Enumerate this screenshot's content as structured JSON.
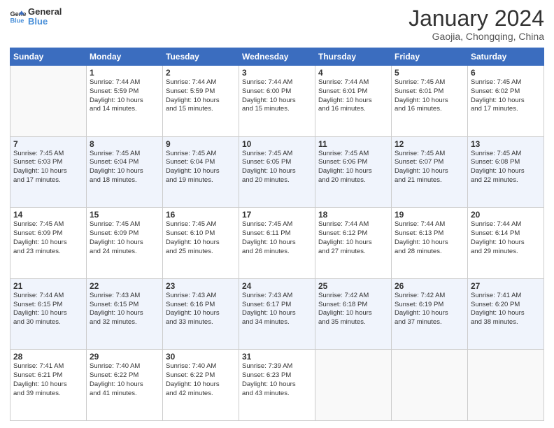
{
  "logo": {
    "line1": "General",
    "line2": "Blue"
  },
  "calendar": {
    "title": "January 2024",
    "subtitle": "Gaojia, Chongqing, China"
  },
  "headers": [
    "Sunday",
    "Monday",
    "Tuesday",
    "Wednesday",
    "Thursday",
    "Friday",
    "Saturday"
  ],
  "weeks": [
    [
      {
        "day": "",
        "info": ""
      },
      {
        "day": "1",
        "info": "Sunrise: 7:44 AM\nSunset: 5:59 PM\nDaylight: 10 hours\nand 14 minutes."
      },
      {
        "day": "2",
        "info": "Sunrise: 7:44 AM\nSunset: 5:59 PM\nDaylight: 10 hours\nand 15 minutes."
      },
      {
        "day": "3",
        "info": "Sunrise: 7:44 AM\nSunset: 6:00 PM\nDaylight: 10 hours\nand 15 minutes."
      },
      {
        "day": "4",
        "info": "Sunrise: 7:44 AM\nSunset: 6:01 PM\nDaylight: 10 hours\nand 16 minutes."
      },
      {
        "day": "5",
        "info": "Sunrise: 7:45 AM\nSunset: 6:01 PM\nDaylight: 10 hours\nand 16 minutes."
      },
      {
        "day": "6",
        "info": "Sunrise: 7:45 AM\nSunset: 6:02 PM\nDaylight: 10 hours\nand 17 minutes."
      }
    ],
    [
      {
        "day": "7",
        "info": "Sunrise: 7:45 AM\nSunset: 6:03 PM\nDaylight: 10 hours\nand 17 minutes."
      },
      {
        "day": "8",
        "info": "Sunrise: 7:45 AM\nSunset: 6:04 PM\nDaylight: 10 hours\nand 18 minutes."
      },
      {
        "day": "9",
        "info": "Sunrise: 7:45 AM\nSunset: 6:04 PM\nDaylight: 10 hours\nand 19 minutes."
      },
      {
        "day": "10",
        "info": "Sunrise: 7:45 AM\nSunset: 6:05 PM\nDaylight: 10 hours\nand 20 minutes."
      },
      {
        "day": "11",
        "info": "Sunrise: 7:45 AM\nSunset: 6:06 PM\nDaylight: 10 hours\nand 20 minutes."
      },
      {
        "day": "12",
        "info": "Sunrise: 7:45 AM\nSunset: 6:07 PM\nDaylight: 10 hours\nand 21 minutes."
      },
      {
        "day": "13",
        "info": "Sunrise: 7:45 AM\nSunset: 6:08 PM\nDaylight: 10 hours\nand 22 minutes."
      }
    ],
    [
      {
        "day": "14",
        "info": "Sunrise: 7:45 AM\nSunset: 6:09 PM\nDaylight: 10 hours\nand 23 minutes."
      },
      {
        "day": "15",
        "info": "Sunrise: 7:45 AM\nSunset: 6:09 PM\nDaylight: 10 hours\nand 24 minutes."
      },
      {
        "day": "16",
        "info": "Sunrise: 7:45 AM\nSunset: 6:10 PM\nDaylight: 10 hours\nand 25 minutes."
      },
      {
        "day": "17",
        "info": "Sunrise: 7:45 AM\nSunset: 6:11 PM\nDaylight: 10 hours\nand 26 minutes."
      },
      {
        "day": "18",
        "info": "Sunrise: 7:44 AM\nSunset: 6:12 PM\nDaylight: 10 hours\nand 27 minutes."
      },
      {
        "day": "19",
        "info": "Sunrise: 7:44 AM\nSunset: 6:13 PM\nDaylight: 10 hours\nand 28 minutes."
      },
      {
        "day": "20",
        "info": "Sunrise: 7:44 AM\nSunset: 6:14 PM\nDaylight: 10 hours\nand 29 minutes."
      }
    ],
    [
      {
        "day": "21",
        "info": "Sunrise: 7:44 AM\nSunset: 6:15 PM\nDaylight: 10 hours\nand 30 minutes."
      },
      {
        "day": "22",
        "info": "Sunrise: 7:43 AM\nSunset: 6:15 PM\nDaylight: 10 hours\nand 32 minutes."
      },
      {
        "day": "23",
        "info": "Sunrise: 7:43 AM\nSunset: 6:16 PM\nDaylight: 10 hours\nand 33 minutes."
      },
      {
        "day": "24",
        "info": "Sunrise: 7:43 AM\nSunset: 6:17 PM\nDaylight: 10 hours\nand 34 minutes."
      },
      {
        "day": "25",
        "info": "Sunrise: 7:42 AM\nSunset: 6:18 PM\nDaylight: 10 hours\nand 35 minutes."
      },
      {
        "day": "26",
        "info": "Sunrise: 7:42 AM\nSunset: 6:19 PM\nDaylight: 10 hours\nand 37 minutes."
      },
      {
        "day": "27",
        "info": "Sunrise: 7:41 AM\nSunset: 6:20 PM\nDaylight: 10 hours\nand 38 minutes."
      }
    ],
    [
      {
        "day": "28",
        "info": "Sunrise: 7:41 AM\nSunset: 6:21 PM\nDaylight: 10 hours\nand 39 minutes."
      },
      {
        "day": "29",
        "info": "Sunrise: 7:40 AM\nSunset: 6:22 PM\nDaylight: 10 hours\nand 41 minutes."
      },
      {
        "day": "30",
        "info": "Sunrise: 7:40 AM\nSunset: 6:22 PM\nDaylight: 10 hours\nand 42 minutes."
      },
      {
        "day": "31",
        "info": "Sunrise: 7:39 AM\nSunset: 6:23 PM\nDaylight: 10 hours\nand 43 minutes."
      },
      {
        "day": "",
        "info": ""
      },
      {
        "day": "",
        "info": ""
      },
      {
        "day": "",
        "info": ""
      }
    ]
  ]
}
